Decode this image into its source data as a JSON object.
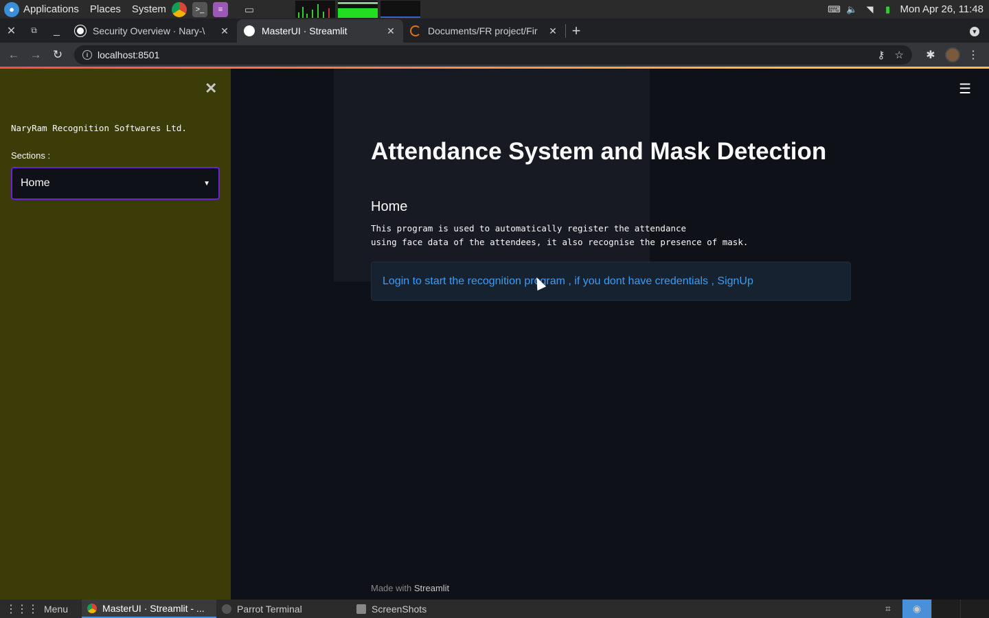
{
  "os_panel": {
    "applications": "Applications",
    "places": "Places",
    "system": "System",
    "clock": "Mon Apr 26, 11:48"
  },
  "browser": {
    "tabs": [
      {
        "title": "Security Overview · Nary-\\",
        "active": false
      },
      {
        "title": "MasterUI · Streamlit",
        "active": true
      },
      {
        "title": "Documents/FR project/Fir",
        "active": false
      }
    ],
    "url": "localhost:8501"
  },
  "sidebar": {
    "company": "NaryRam Recognition Softwares Ltd.",
    "sections_label": "Sections :",
    "selected_section": "Home",
    "bg_color": "#3c3c08",
    "focus_color": "#6b21d6"
  },
  "main": {
    "title": "Attendance System and Mask Detection",
    "subheading": "Home",
    "description": "This program is used to automatically register the attendance\nusing face data of the attendees, it also recognise the presence of mask.",
    "info_message": "Login to start the recognition program , if you dont have credentials , SignUp",
    "footer_prefix": "Made with",
    "footer_brand": "Streamlit"
  },
  "taskbar": {
    "menu": "Menu",
    "items": [
      {
        "label": "MasterUI · Streamlit - ...",
        "active": true
      },
      {
        "label": "Parrot Terminal",
        "active": false
      },
      {
        "label": "ScreenShots",
        "active": false
      }
    ]
  }
}
